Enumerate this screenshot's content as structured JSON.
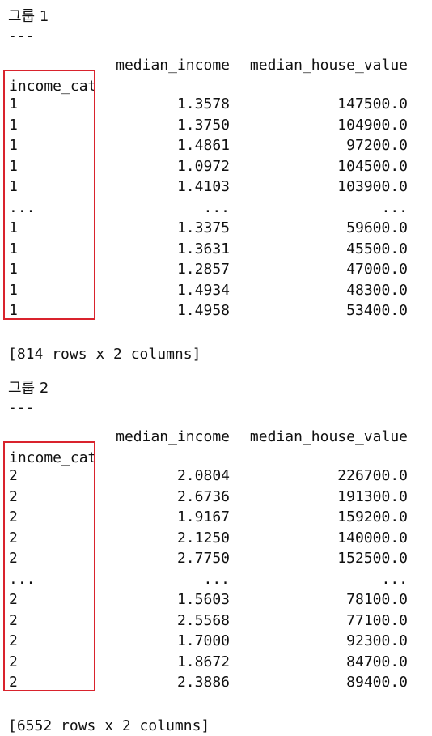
{
  "groups": [
    {
      "title": "그룹 1",
      "separator": "---",
      "columns": [
        "median_income",
        "median_house_value"
      ],
      "index_name": "income_cat",
      "rows": [
        {
          "idx": "1",
          "income": "1.3578",
          "house": "147500.0"
        },
        {
          "idx": "1",
          "income": "1.3750",
          "house": "104900.0"
        },
        {
          "idx": "1",
          "income": "1.4861",
          "house": "97200.0"
        },
        {
          "idx": "1",
          "income": "1.0972",
          "house": "104500.0"
        },
        {
          "idx": "1",
          "income": "1.4103",
          "house": "103900.0"
        },
        {
          "idx": "...",
          "income": "...",
          "house": "..."
        },
        {
          "idx": "1",
          "income": "1.3375",
          "house": "59600.0"
        },
        {
          "idx": "1",
          "income": "1.3631",
          "house": "45500.0"
        },
        {
          "idx": "1",
          "income": "1.2857",
          "house": "47000.0"
        },
        {
          "idx": "1",
          "income": "1.4934",
          "house": "48300.0"
        },
        {
          "idx": "1",
          "income": "1.4958",
          "house": "53400.0"
        }
      ],
      "summary": "[814 rows x 2 columns]"
    },
    {
      "title": "그룹 2",
      "separator": "---",
      "columns": [
        "median_income",
        "median_house_value"
      ],
      "index_name": "income_cat",
      "rows": [
        {
          "idx": "2",
          "income": "2.0804",
          "house": "226700.0"
        },
        {
          "idx": "2",
          "income": "2.6736",
          "house": "191300.0"
        },
        {
          "idx": "2",
          "income": "1.9167",
          "house": "159200.0"
        },
        {
          "idx": "2",
          "income": "2.1250",
          "house": "140000.0"
        },
        {
          "idx": "2",
          "income": "2.7750",
          "house": "152500.0"
        },
        {
          "idx": "...",
          "income": "...",
          "house": "..."
        },
        {
          "idx": "2",
          "income": "1.5603",
          "house": "78100.0"
        },
        {
          "idx": "2",
          "income": "2.5568",
          "house": "77100.0"
        },
        {
          "idx": "2",
          "income": "1.7000",
          "house": "92300.0"
        },
        {
          "idx": "2",
          "income": "1.8672",
          "house": "84700.0"
        },
        {
          "idx": "2",
          "income": "2.3886",
          "house": "89400.0"
        }
      ],
      "summary": "[6552 rows x 2 columns]"
    }
  ],
  "colors": {
    "highlight_border": "#d9232d",
    "text": "#111111",
    "background": "#ffffff"
  }
}
